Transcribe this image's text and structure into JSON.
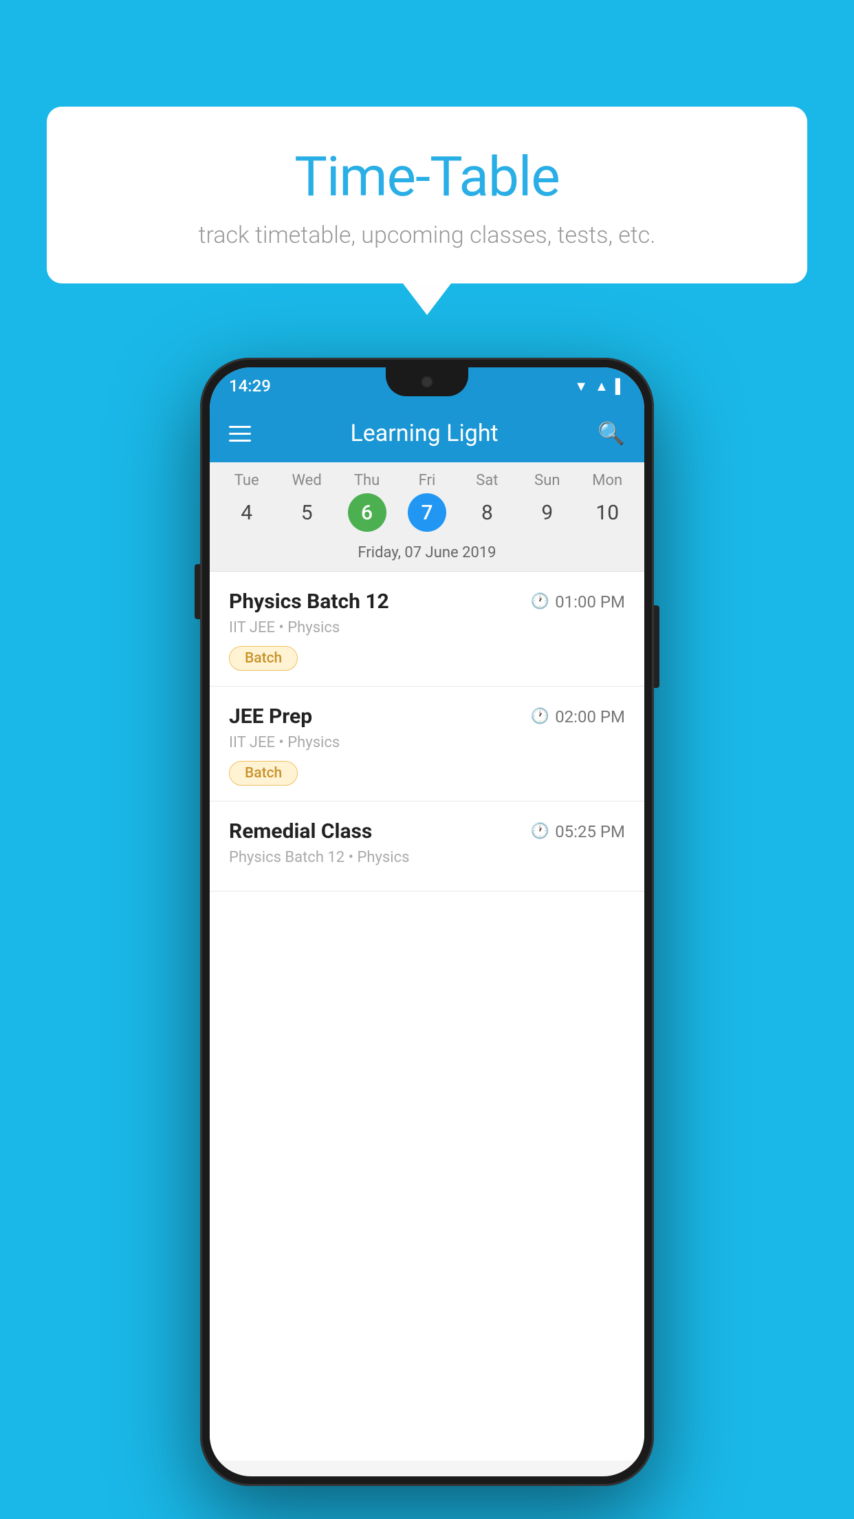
{
  "background": {
    "color": "#1ab8e8"
  },
  "speech_bubble": {
    "title": "Time-Table",
    "subtitle": "track timetable, upcoming classes, tests, etc."
  },
  "phone": {
    "status_bar": {
      "time": "14:29"
    },
    "header": {
      "title": "Learning Light"
    },
    "calendar": {
      "selected_date_label": "Friday, 07 June 2019",
      "days": [
        {
          "label": "Tue",
          "num": "4",
          "state": "normal"
        },
        {
          "label": "Wed",
          "num": "5",
          "state": "normal"
        },
        {
          "label": "Thu",
          "num": "6",
          "state": "today"
        },
        {
          "label": "Fri",
          "num": "7",
          "state": "selected"
        },
        {
          "label": "Sat",
          "num": "8",
          "state": "normal"
        },
        {
          "label": "Sun",
          "num": "9",
          "state": "normal"
        },
        {
          "label": "Mon",
          "num": "10",
          "state": "normal"
        }
      ]
    },
    "schedule": [
      {
        "title": "Physics Batch 12",
        "time": "01:00 PM",
        "subtitle": "IIT JEE • Physics",
        "badge": "Batch"
      },
      {
        "title": "JEE Prep",
        "time": "02:00 PM",
        "subtitle": "IIT JEE • Physics",
        "badge": "Batch"
      },
      {
        "title": "Remedial Class",
        "time": "05:25 PM",
        "subtitle": "Physics Batch 12 • Physics",
        "badge": null
      }
    ]
  }
}
